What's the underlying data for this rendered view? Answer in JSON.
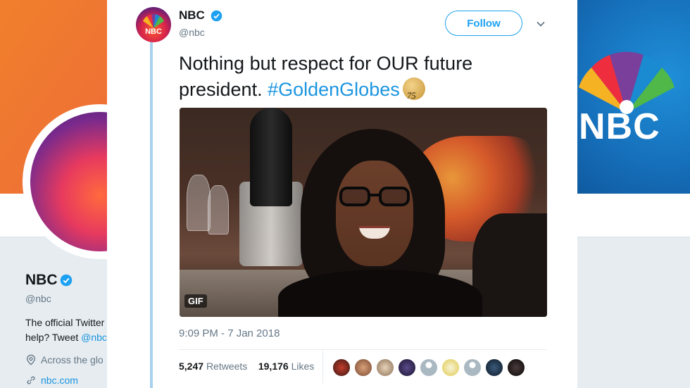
{
  "profile": {
    "name": "NBC",
    "handle": "@nbc",
    "bio_start": "The official Twitter",
    "bio_line2": "help? Tweet",
    "bio_link": "@nbc",
    "location": "Across the glo",
    "url": "nbc.com"
  },
  "background": {
    "logo_text": "NBC"
  },
  "tweet": {
    "avatar_text": "NBC",
    "display_name": "NBC",
    "username": "@nbc",
    "follow_label": "Follow",
    "text": "Nothing but respect for OUR future president.",
    "hashtag": "#GoldenGlobes",
    "hashflag_text": "75",
    "gif_badge": "GIF",
    "timestamp": "9:09 PM - 7 Jan 2018",
    "retweets_count": "5,247",
    "retweets_label": "Retweets",
    "likes_count": "19,176",
    "likes_label": "Likes"
  },
  "colors": {
    "accent": "#1da1f2",
    "link": "#1b95e0",
    "verified": "#1da1f2",
    "thread": "#a7d1ef"
  },
  "icons": {
    "verified": "verified-badge-icon",
    "caret": "chevron-down-icon",
    "location": "location-pin-icon",
    "link": "link-icon"
  }
}
